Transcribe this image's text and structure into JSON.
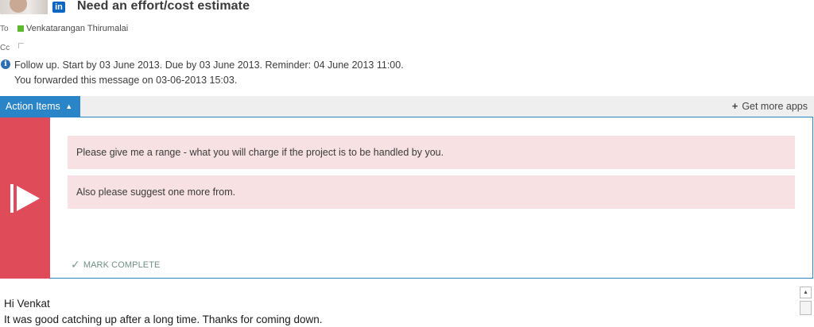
{
  "header": {
    "subject": "Need an effort/cost estimate",
    "linkedin_badge": "in",
    "to_label": "To",
    "to_name": "Venkatarangan Thirumalai",
    "cc_label": "Cc",
    "presence_color": "#5cb82e"
  },
  "info": {
    "line1": "Follow up.  Start by 03 June 2013.  Due by 03 June 2013.  Reminder: 04 June 2013 11:00.",
    "line2": "You forwarded this message on 03-06-2013 15:03."
  },
  "appbar": {
    "tab_label": "Action Items",
    "get_apps_label": "Get more apps",
    "accent": "#2a85c8"
  },
  "action_items": {
    "items": [
      "Please give me a range - what you will charge if the project is to be handled by you.",
      "Also please suggest one more  from."
    ],
    "mark_complete_label": "MARK COMPLETE",
    "strip_color": "#e04b5a",
    "item_bg": "#f8e1e3"
  },
  "body": {
    "greeting": "Hi Venkat",
    "line1": "It was good catching up after a long time. Thanks for coming down."
  },
  "icons": [
    "linkedin-icon",
    "presence-icon",
    "info-icon",
    "chevron-up-icon",
    "plus-icon",
    "flag-icon",
    "check-icon",
    "scroll-up-icon"
  ]
}
